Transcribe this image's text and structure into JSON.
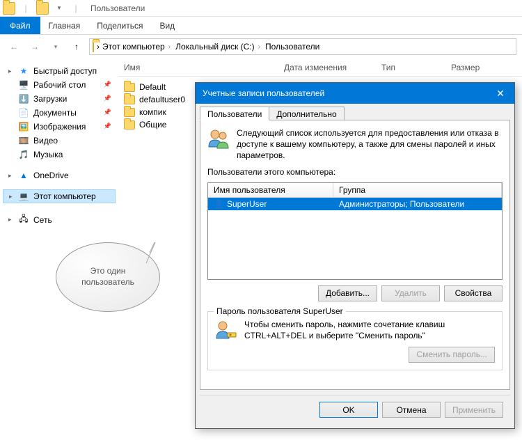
{
  "titlebar": {
    "window_title": "Пользователи"
  },
  "ribbon": {
    "file": "Файл",
    "tabs": [
      "Главная",
      "Поделиться",
      "Вид"
    ]
  },
  "breadcrumb": {
    "items": [
      "Этот компьютер",
      "Локальный диск (C:)",
      "Пользователи"
    ]
  },
  "columns": {
    "name": "Имя",
    "date": "Дата изменения",
    "type": "Тип",
    "size": "Размер"
  },
  "sidebar": {
    "quick_access": {
      "label": "Быстрый доступ"
    },
    "items": [
      {
        "label": "Рабочий стол",
        "icon": "🖥️",
        "pinned": true
      },
      {
        "label": "Загрузки",
        "icon": "⬇️",
        "pinned": true
      },
      {
        "label": "Документы",
        "icon": "📄",
        "pinned": true
      },
      {
        "label": "Изображения",
        "icon": "🖼️",
        "pinned": true
      },
      {
        "label": "Видео",
        "icon": "🎞️",
        "pinned": false
      },
      {
        "label": "Музыка",
        "icon": "🎵",
        "pinned": false
      }
    ],
    "onedrive": {
      "label": "OneDrive",
      "icon": "☁️"
    },
    "this_pc": {
      "label": "Этот компьютер",
      "icon": "💻"
    },
    "network": {
      "label": "Сеть",
      "icon": "🖧"
    }
  },
  "folders": [
    {
      "name": "Default"
    },
    {
      "name": "defaultuser0"
    },
    {
      "name": "компик"
    },
    {
      "name": "Общие"
    }
  ],
  "dialog": {
    "title": "Учетные записи пользователей",
    "tabs": {
      "users": "Пользователи",
      "advanced": "Дополнительно"
    },
    "info_text": "Следующий список используется для предоставления или отказа в доступе к вашему компьютеру, а также для смены паролей и иных параметров.",
    "list_label": "Пользователи этого компьютера:",
    "cols": {
      "name": "Имя пользователя",
      "group": "Группа"
    },
    "rows": [
      {
        "name": "SuperUser",
        "group": "Администраторы; Пользователи"
      }
    ],
    "buttons": {
      "add": "Добавить...",
      "remove": "Удалить",
      "props": "Свойства"
    },
    "pw_group_title": "Пароль пользователя SuperUser",
    "pw_hint": "Чтобы сменить пароль, нажмите сочетание клавиш CTRL+ALT+DEL и выберите \"Сменить пароль\"",
    "pw_button": "Сменить пароль...",
    "footer": {
      "ok": "OK",
      "cancel": "Отмена",
      "apply": "Применить"
    }
  },
  "callout": {
    "text": "Это один пользователь"
  }
}
